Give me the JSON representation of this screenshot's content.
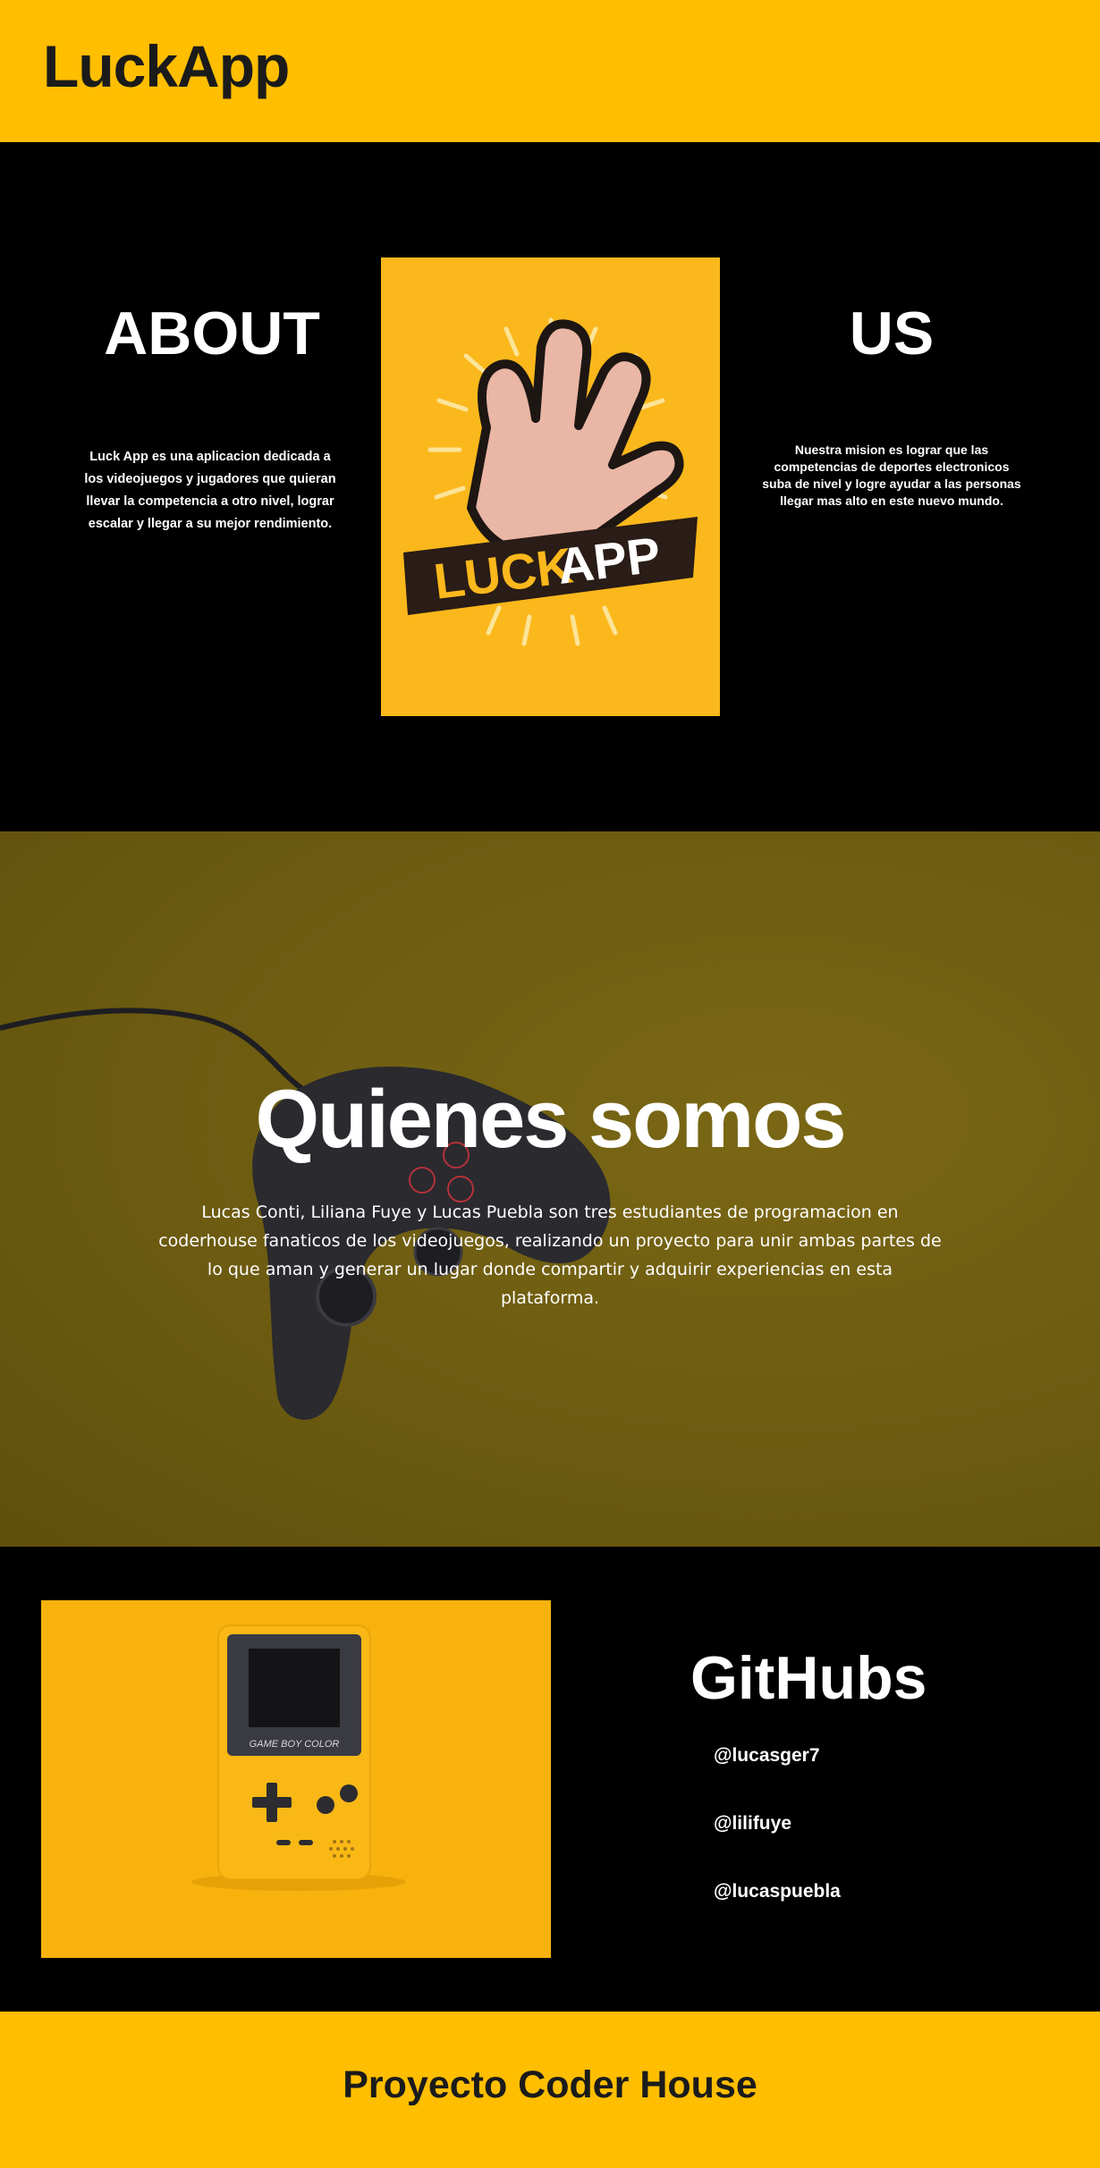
{
  "header": {
    "brand": "LuckApp"
  },
  "about": {
    "title_left": "ABOUT",
    "title_right": "US",
    "text_left": "Luck App es una aplicacion dedicada a los videojuegos y jugadores que quieran llevar la competencia a otro nivel, lograr escalar y llegar a su mejor rendimiento.",
    "text_right": "Nuestra mision es lograr que las competencias de deportes electronicos suba de nivel y logre ayudar a las personas llegar mas alto en este nuevo mundo.",
    "logo": {
      "text_luck": "LUCK",
      "text_app": "APP",
      "icon": "hand-logo-icon"
    }
  },
  "quienes": {
    "title": "Quienes somos",
    "text": "Lucas Conti, Liliana Fuye y Lucas Puebla son tres estudiantes de programacion en coderhouse fanaticos de los videojuegos, realizando un proyecto para unir ambas partes de lo que aman y generar un lugar donde compartir y adquirir experiencias en esta plataforma.",
    "background_icon": "game-controller-icon"
  },
  "github": {
    "title": "GitHubs",
    "links": [
      "@lucasger7",
      "@lilifuye",
      "@lucaspuebla"
    ],
    "image": {
      "label": "GAME BOY COLOR",
      "icon": "gameboy-icon"
    }
  },
  "footer": {
    "text": "Proyecto Coder House"
  },
  "colors": {
    "accent": "#ffbe00",
    "background": "#000000",
    "text": "#ffffff",
    "dark_text": "#1b1b1b"
  }
}
